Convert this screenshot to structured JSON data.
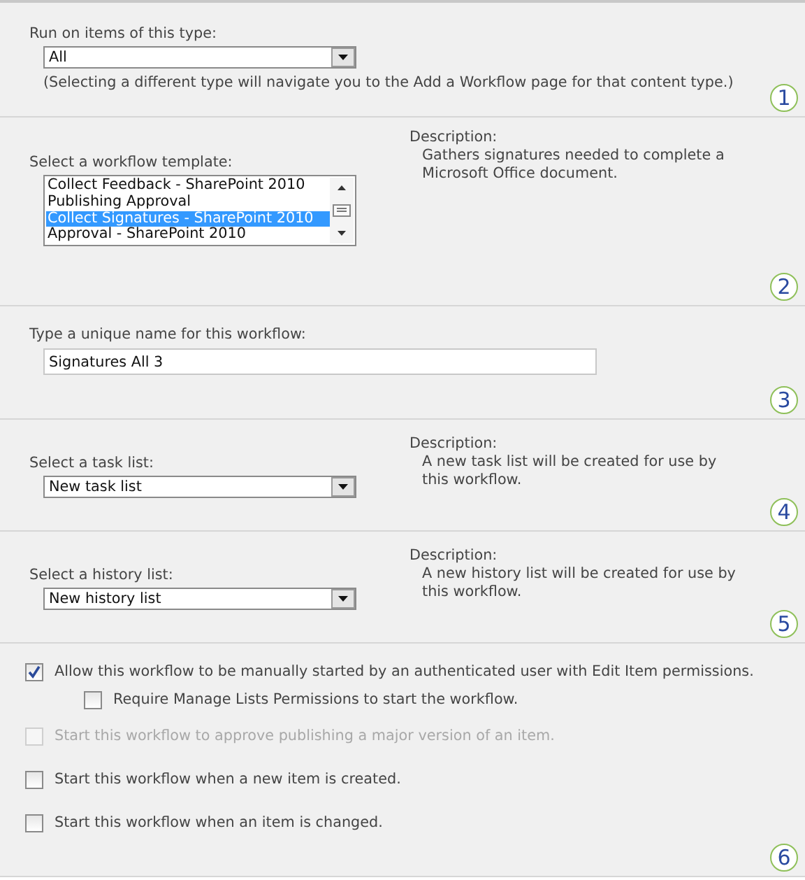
{
  "sections": [
    {
      "kind": "type",
      "label": "Run on items of this type:",
      "value": "All",
      "note": "(Selecting a different type will navigate you to the Add a Workflow page for that content type.)",
      "number": "1"
    },
    {
      "kind": "template",
      "label": "Select a workflow template:",
      "options": [
        {
          "label": "Collect Feedback - SharePoint 2010",
          "selected": false
        },
        {
          "label": "Publishing Approval",
          "selected": false
        },
        {
          "label": "Collect Signatures - SharePoint 2010",
          "selected": true
        },
        {
          "label": "Approval - SharePoint 2010",
          "selected": false
        }
      ],
      "description_label": "Description:",
      "description": "Gathers signatures needed to complete a Microsoft Office document.",
      "number": "2"
    },
    {
      "kind": "name",
      "label": "Type a unique name for this workflow:",
      "value": "Signatures All 3",
      "number": "3"
    },
    {
      "kind": "list",
      "label": "Select a task list:",
      "value": "New task list",
      "description_label": "Description:",
      "description": "A new task list will be created for use by this workflow.",
      "number": "4"
    },
    {
      "kind": "list",
      "label": "Select a history list:",
      "value": "New history list",
      "description_label": "Description:",
      "description": "A new history list will be created for use by this workflow.",
      "number": "5"
    },
    {
      "kind": "options",
      "checkboxes": [
        {
          "label": "Allow this workflow to be manually started by an authenticated user with Edit Item permissions.",
          "checked": true,
          "disabled": false,
          "children": [
            {
              "label": "Require Manage Lists Permissions to start the workflow.",
              "checked": false,
              "disabled": false
            }
          ]
        },
        {
          "label": "Start this workflow to approve publishing a major version of an item.",
          "checked": false,
          "disabled": true
        },
        {
          "label": "Start this workflow when a new item is created.",
          "checked": false,
          "disabled": false
        },
        {
          "label": "Start this workflow when an item is changed.",
          "checked": false,
          "disabled": false
        }
      ],
      "number": "6"
    }
  ]
}
